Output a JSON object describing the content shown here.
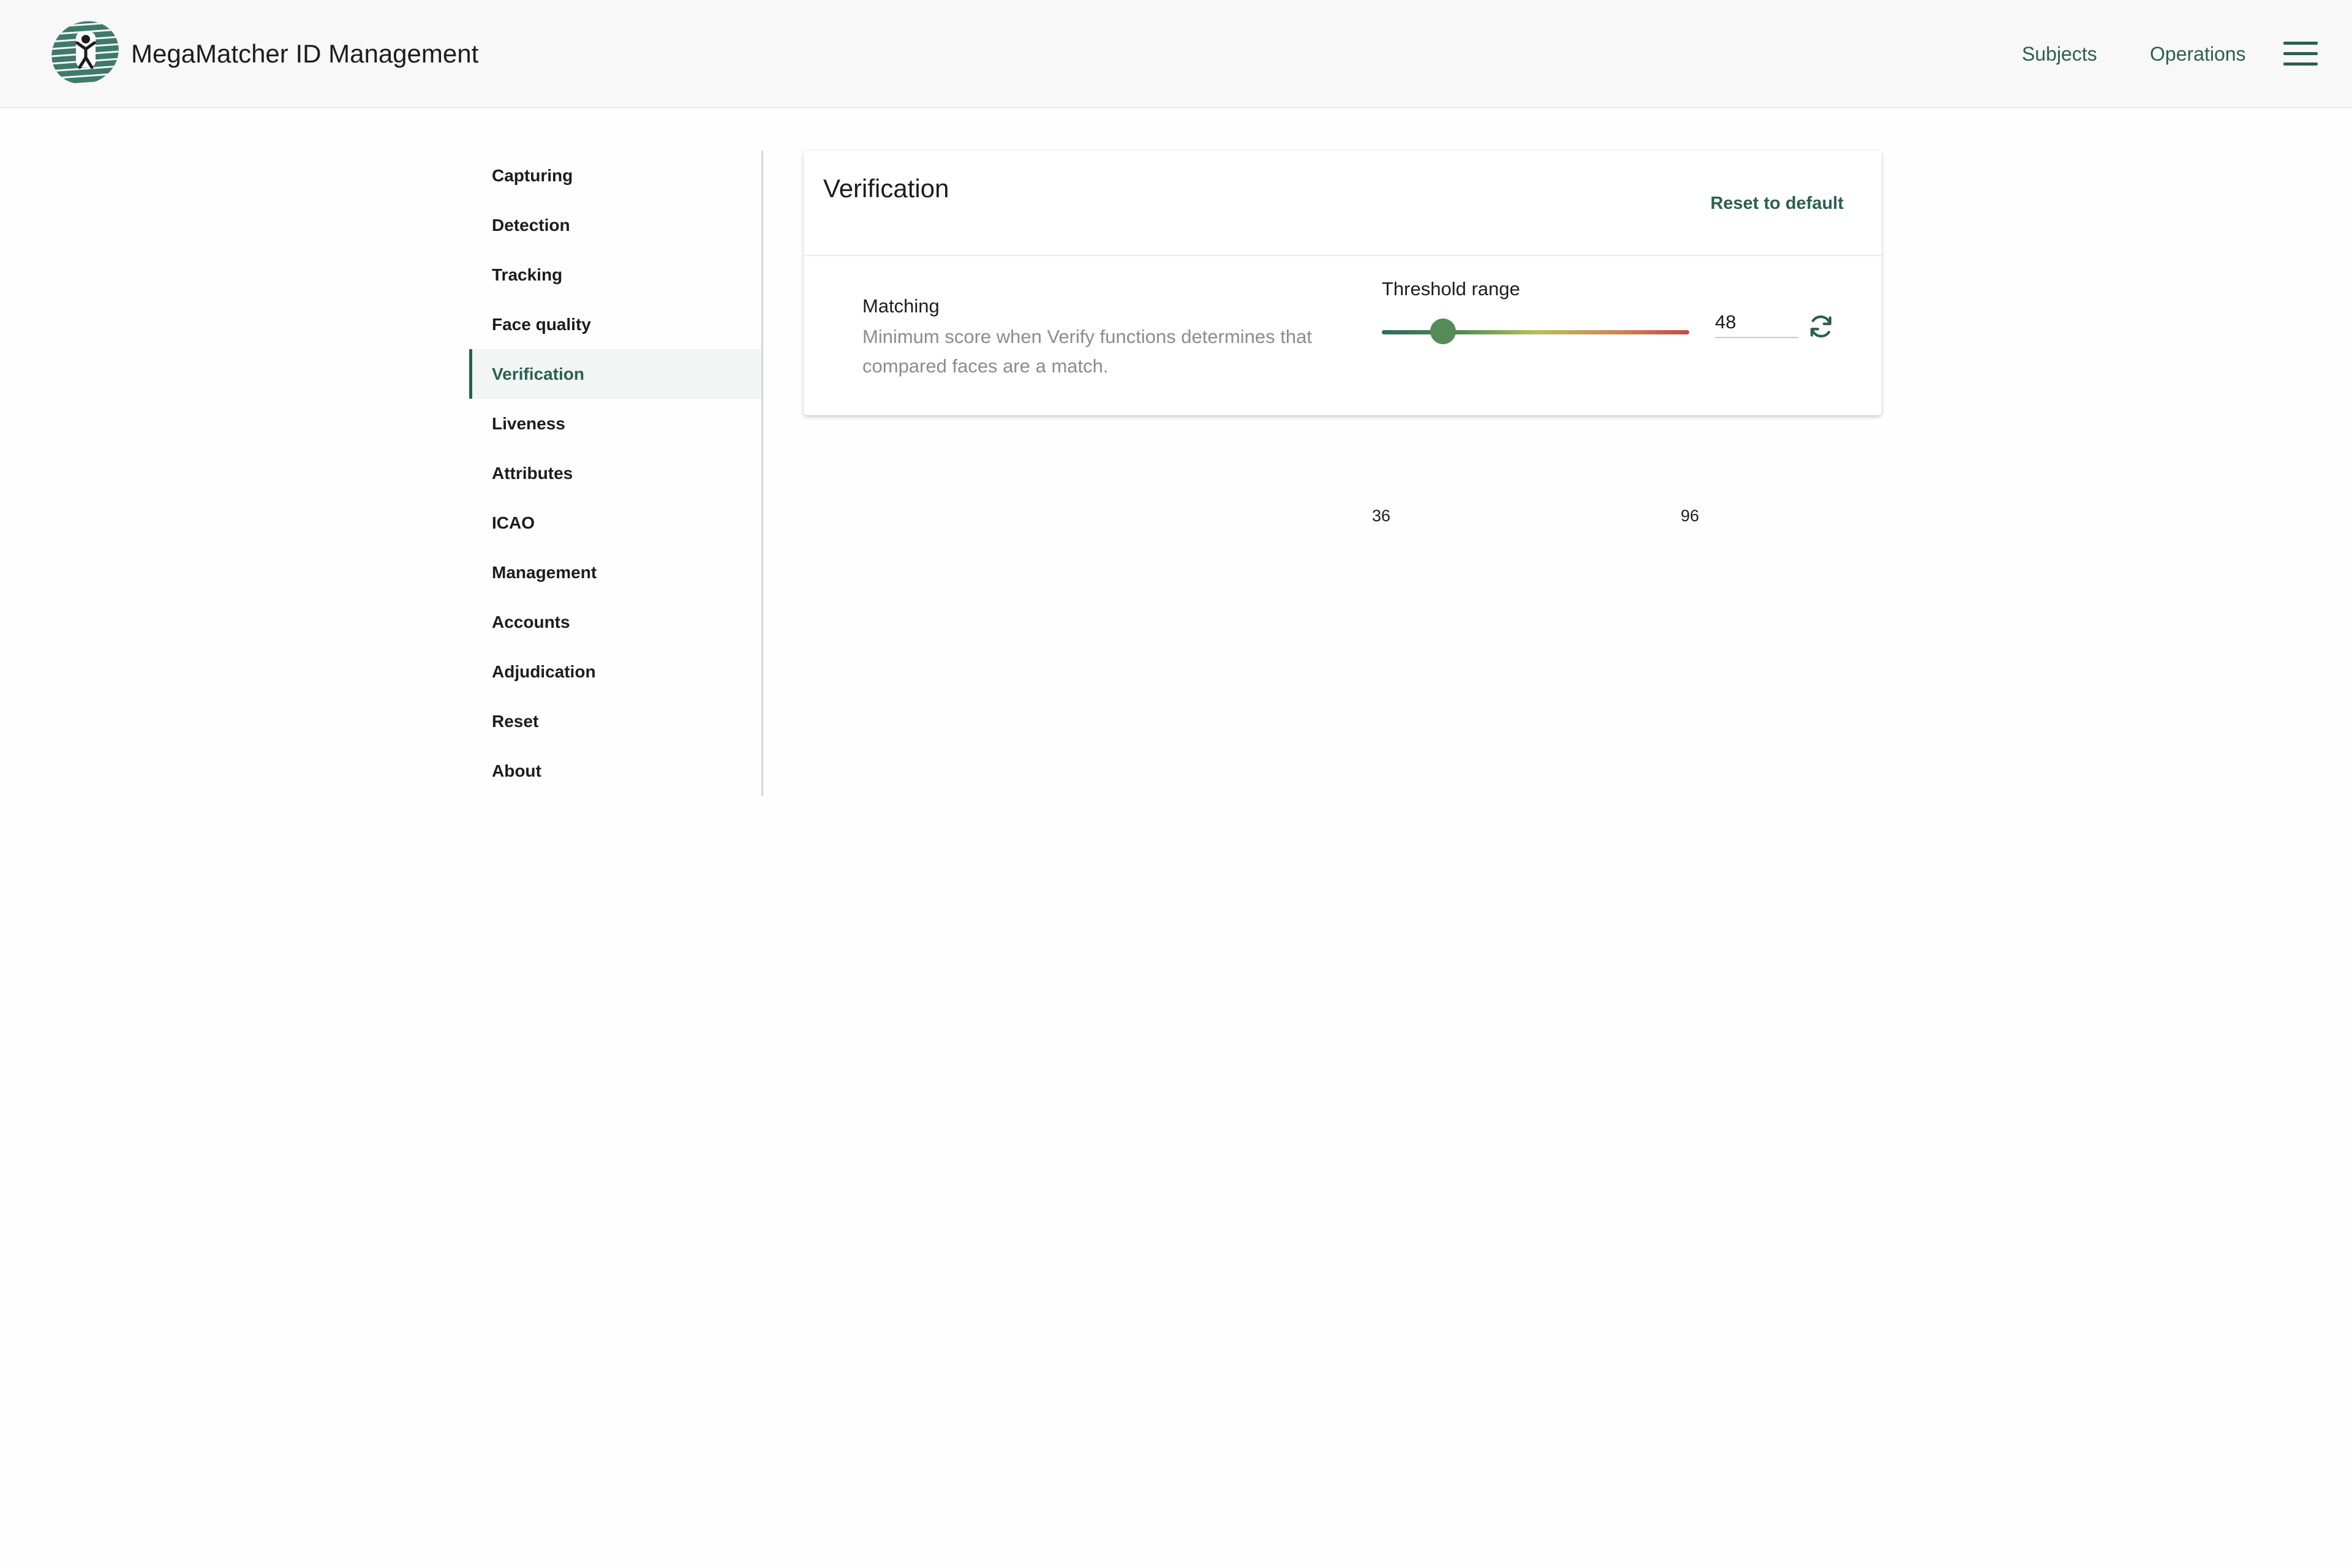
{
  "header": {
    "app_title": "MegaMatcher ID Management",
    "nav": {
      "subjects": "Subjects",
      "operations": "Operations"
    },
    "logo_icon": "megamatcher-logo",
    "menu_icon": "hamburger-menu-icon"
  },
  "sidebar": {
    "items": [
      {
        "label": "Capturing",
        "active": false
      },
      {
        "label": "Detection",
        "active": false
      },
      {
        "label": "Tracking",
        "active": false
      },
      {
        "label": "Face quality",
        "active": false
      },
      {
        "label": "Verification",
        "active": true
      },
      {
        "label": "Liveness",
        "active": false
      },
      {
        "label": "Attributes",
        "active": false
      },
      {
        "label": "ICAO",
        "active": false
      },
      {
        "label": "Management",
        "active": false
      },
      {
        "label": "Accounts",
        "active": false
      },
      {
        "label": "Adjudication",
        "active": false
      },
      {
        "label": "Reset",
        "active": false
      },
      {
        "label": "About",
        "active": false
      }
    ]
  },
  "card": {
    "title": "Verification",
    "reset_label": "Reset to default",
    "setting": {
      "name": "Matching",
      "description": "Minimum score when Verify functions determines that compared faces are a match.",
      "threshold_label": "Threshold range",
      "min": "36",
      "max": "96",
      "value": "48",
      "refresh_icon": "refresh-icon"
    }
  },
  "colors": {
    "accent": "#2c5f4f",
    "header_bg": "#f8f8f8",
    "active_bg": "#f1f5f4",
    "slider_thumb": "#568a56",
    "slider_gradient": [
      "#2c6e58",
      "#b4c35a",
      "#c84848"
    ]
  }
}
